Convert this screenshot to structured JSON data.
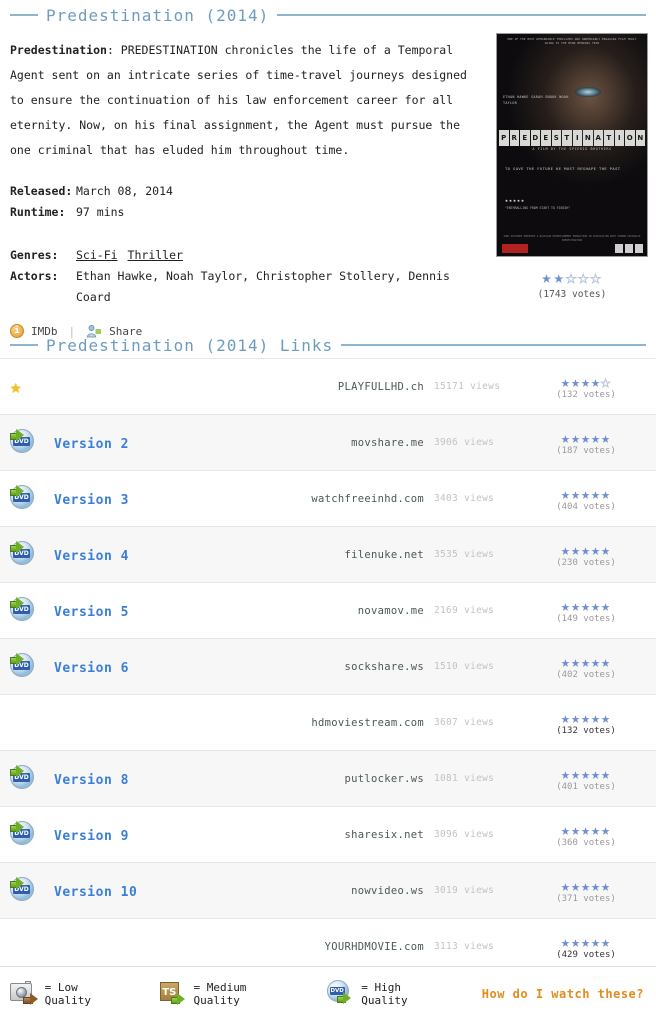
{
  "header": {
    "title": "Predestination  (2014)"
  },
  "movie": {
    "name_bold": "Predestination",
    "synopsis_rest": ": PREDESTINATION chronicles the life of a Temporal Agent sent on an intricate series of time-travel journeys designed to ensure the continuation of his law enforcement career for all eternity. Now, on his final assignment, the Agent must pursue the one criminal that has eluded him throughout time.",
    "released_label": "Released:",
    "released_value": "March 08, 2014",
    "runtime_label": "Runtime:",
    "runtime_value": "97 mins",
    "genres_label": "Genres:",
    "genres": [
      "Sci-Fi",
      "Thriller"
    ],
    "actors_label": "Actors:",
    "actors_value": "Ethan Hawke, Noah Taylor, Christopher Stollery, Dennis Coard",
    "imdb_label": "IMDb",
    "share_label": "Share",
    "rating_filled": 2,
    "rating_total": 5,
    "votes": "(1743 votes)",
    "poster": {
      "top_blurb": "ONE OF THE MOST REMARKABLE THRILLERS AND UNDENIABLY ENGAGING FILM TRULY GOING TO THE MIND BENDING YEAR",
      "cast": "ETHAN HAWKE   SARAH SNOOK   NOAH TAYLOR",
      "title_letters": [
        "P",
        "R",
        "E",
        "D",
        "E",
        "S",
        "T",
        "I",
        "N",
        "A",
        "T",
        "I",
        "O",
        "N"
      ],
      "subtitle": "A FILM BY THE SPIERIG BROTHERS",
      "tagline": "TO SAVE THE FUTURE HE MUST RESHAPE THE PAST",
      "star_row": "★★★★★",
      "quote": "\"ENTHRALLING FROM START TO FINISH\"",
      "credits": "SONY PICTURES PRESENTS A BLACKLAB ENTERTAINMENT PRODUCTION IN ASSOCIATION WITH SCREEN AUSTRALIA PREDESTINATION"
    }
  },
  "links_section": {
    "title": "Predestination (2014) Links",
    "rows": [
      {
        "icon": "gold-star-icon",
        "version": "",
        "host": "PLAYFULLHD.ch",
        "views": "15171 views",
        "stars_filled": 4,
        "votes": "(132 votes)",
        "votes_dark": false,
        "alt": false
      },
      {
        "icon": "dvd-icon",
        "version": "Version 2",
        "host": "movshare.me",
        "views": "3906 views",
        "stars_filled": 5,
        "votes": "(187 votes)",
        "votes_dark": false,
        "alt": true
      },
      {
        "icon": "dvd-icon",
        "version": "Version 3",
        "host": "watchfreeinhd.com",
        "views": "3403 views",
        "stars_filled": 5,
        "votes": "(404 votes)",
        "votes_dark": false,
        "alt": false
      },
      {
        "icon": "dvd-icon",
        "version": "Version 4",
        "host": "filenuke.net",
        "views": "3535 views",
        "stars_filled": 5,
        "votes": "(230 votes)",
        "votes_dark": false,
        "alt": true
      },
      {
        "icon": "dvd-icon",
        "version": "Version 5",
        "host": "novamov.me",
        "views": "2169 views",
        "stars_filled": 5,
        "votes": "(149 votes)",
        "votes_dark": false,
        "alt": false
      },
      {
        "icon": "dvd-icon",
        "version": "Version 6",
        "host": "sockshare.ws",
        "views": "1510 views",
        "stars_filled": 5,
        "votes": "(402 votes)",
        "votes_dark": false,
        "alt": true
      },
      {
        "icon": "",
        "version": "",
        "host": "hdmoviestream.com",
        "views": "3607 views",
        "stars_filled": 5,
        "votes": "(132 votes)",
        "votes_dark": true,
        "alt": false
      },
      {
        "icon": "dvd-icon",
        "version": "Version 8",
        "host": "putlocker.ws",
        "views": "1081 views",
        "stars_filled": 5,
        "votes": "(401 votes)",
        "votes_dark": false,
        "alt": true
      },
      {
        "icon": "dvd-icon",
        "version": "Version 9",
        "host": "sharesix.net",
        "views": "3096 views",
        "stars_filled": 5,
        "votes": "(360 votes)",
        "votes_dark": false,
        "alt": false
      },
      {
        "icon": "dvd-icon",
        "version": "Version 10",
        "host": "nowvideo.ws",
        "views": "3019 views",
        "stars_filled": 5,
        "votes": "(371 votes)",
        "votes_dark": false,
        "alt": true
      },
      {
        "icon": "",
        "version": "",
        "host": "YOURHDMOVIE.com",
        "views": "3113 views",
        "stars_filled": 5,
        "votes": "(429 votes)",
        "votes_dark": true,
        "alt": false
      }
    ]
  },
  "footer": {
    "legend": [
      {
        "icon": "camera-icon",
        "label": "= Low Quality"
      },
      {
        "icon": "ts-icon",
        "label": "= Medium Quality"
      },
      {
        "icon": "dvd-icon",
        "label": "= High Quality"
      }
    ],
    "help_link": "How do I watch these?",
    "ts_text": "TS",
    "dvd_text": "DVD"
  },
  "colors": {
    "heading": "#6c9cc0",
    "link": "#3a7fd5",
    "star_on": "#6f8fd2",
    "gold": "#f0c419",
    "help": "#e38b1b"
  }
}
